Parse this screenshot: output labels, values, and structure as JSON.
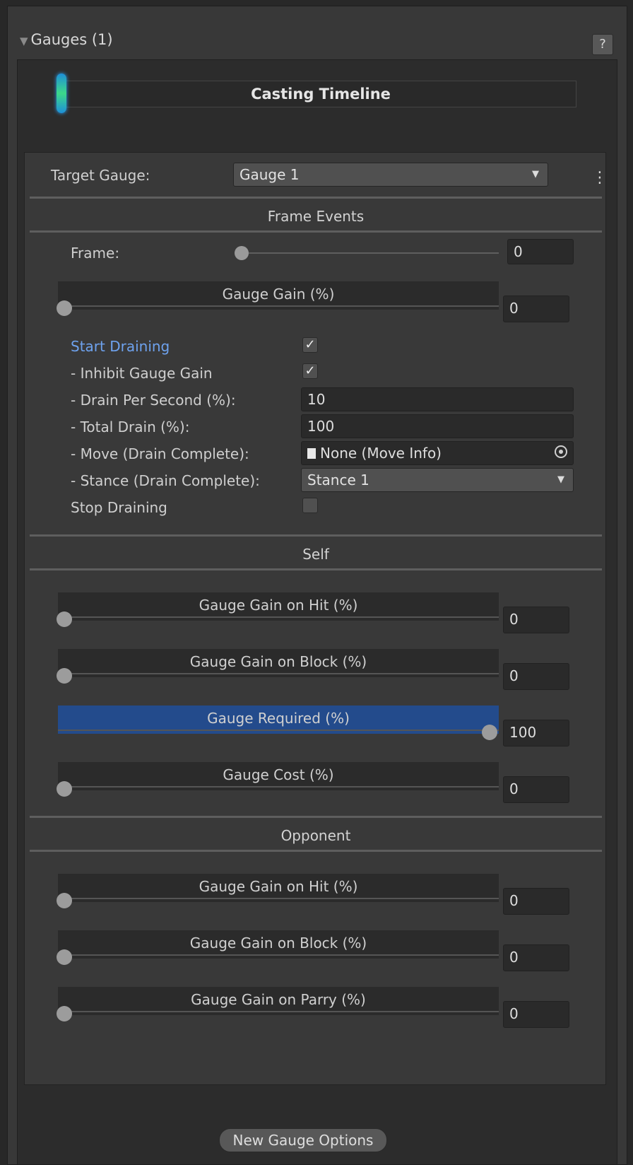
{
  "header": {
    "title": "Gauges (1)",
    "help_label": "?"
  },
  "timeline": {
    "title": "Casting Timeline"
  },
  "target_gauge": {
    "label": "Target Gauge:",
    "value": "Gauge 1"
  },
  "frame_events": {
    "title": "Frame Events",
    "frame": {
      "label": "Frame:",
      "value": "0"
    },
    "gauge_gain": {
      "label": "Gauge Gain (%)",
      "value": "0",
      "level": 0
    },
    "start_draining": {
      "label": "Start Draining",
      "checked": true
    },
    "inhibit_gain": {
      "label": "- Inhibit Gauge Gain",
      "checked": true
    },
    "drain_per_second": {
      "label": "- Drain Per Second (%):",
      "value": "10"
    },
    "total_drain": {
      "label": "- Total Drain (%):",
      "value": "100"
    },
    "move_complete": {
      "label": "- Move (Drain Complete):",
      "value": "None (Move Info)"
    },
    "stance_complete": {
      "label": "- Stance (Drain Complete):",
      "value": "Stance 1"
    },
    "stop_draining": {
      "label": "Stop Draining",
      "checked": false
    }
  },
  "self": {
    "title": "Self",
    "sliders": [
      {
        "label": "Gauge Gain on Hit (%)",
        "value": "0",
        "level": 0
      },
      {
        "label": "Gauge Gain on Block (%)",
        "value": "0",
        "level": 0
      },
      {
        "label": "Gauge Required (%)",
        "value": "100",
        "level": 100
      },
      {
        "label": "Gauge Cost (%)",
        "value": "0",
        "level": 0
      }
    ]
  },
  "opponent": {
    "title": "Opponent",
    "sliders": [
      {
        "label": "Gauge Gain on Hit (%)",
        "value": "0",
        "level": 0
      },
      {
        "label": "Gauge Gain on Block (%)",
        "value": "0",
        "level": 0
      },
      {
        "label": "Gauge Gain on Parry (%)",
        "value": "0",
        "level": 0
      }
    ]
  },
  "new_gauge_button": "New Gauge Options",
  "colors": {
    "accent": "#234b8c",
    "link": "#6ea2ee",
    "panel": "#393939"
  }
}
